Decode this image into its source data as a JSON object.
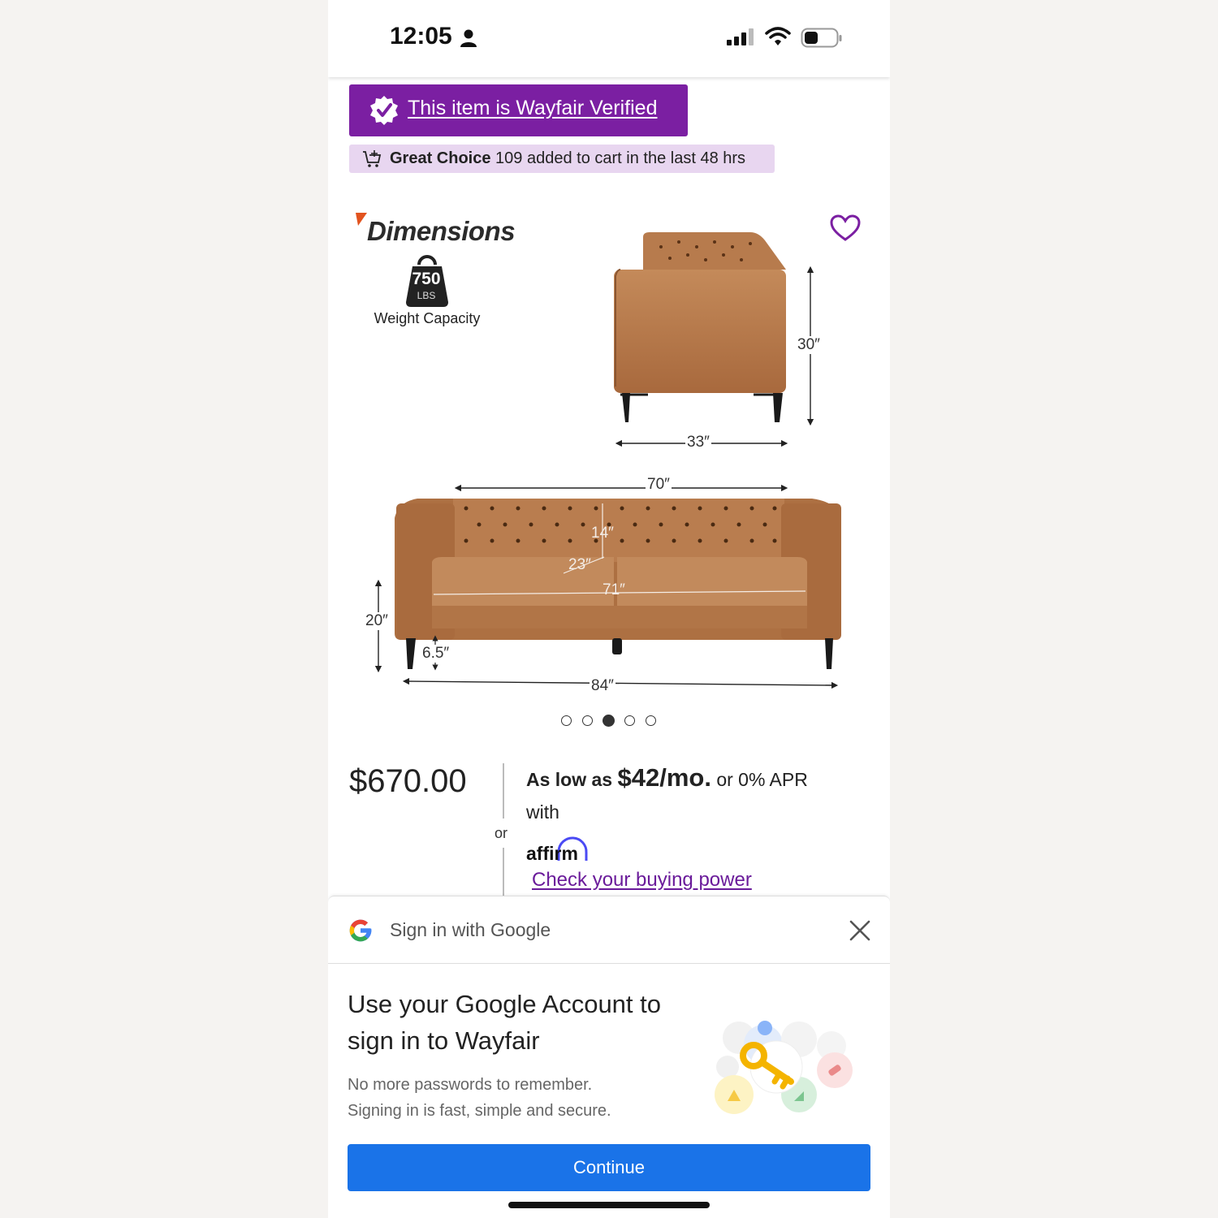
{
  "status_bar": {
    "time": "12:05"
  },
  "banner": {
    "verified_text": "This item is Wayfair Verified",
    "great_choice_label": "Great Choice",
    "great_choice_text": "109 added to cart in the last 48 hrs"
  },
  "gallery": {
    "title": "Dimensions",
    "weight_value": "750",
    "weight_unit": "LBS",
    "weight_label": "Weight Capacity",
    "dims": {
      "side_height": "30″",
      "side_depth": "33″",
      "front_width": "70″",
      "back_height": "14″",
      "seat_depth": "23″",
      "seat_width": "71″",
      "seat_height": "20″",
      "leg_height": "6.5″",
      "overall_width": "84″"
    },
    "dot_count": 5,
    "active_dot": 3
  },
  "pricing": {
    "price": "$670.00",
    "or_label": "or",
    "as_low_as": "As low as",
    "monthly": "$42/mo.",
    "apr_text": "or 0% APR",
    "with_text": "with",
    "affirm_logo": "affirm",
    "check_link": "Check your buying power"
  },
  "google_sheet": {
    "title": "Sign in with Google",
    "headline": "Use your Google Account to sign in to Wayfair",
    "subtext_line1": "No more passwords to remember.",
    "subtext_line2": "Signing in is fast, simple and secure.",
    "continue_label": "Continue"
  },
  "colors": {
    "wayfair_purple": "#7b1fa2",
    "great_choice_bg": "#e8d6f0",
    "google_blue": "#1a73e8",
    "sofa_leather": "#b5794c"
  }
}
